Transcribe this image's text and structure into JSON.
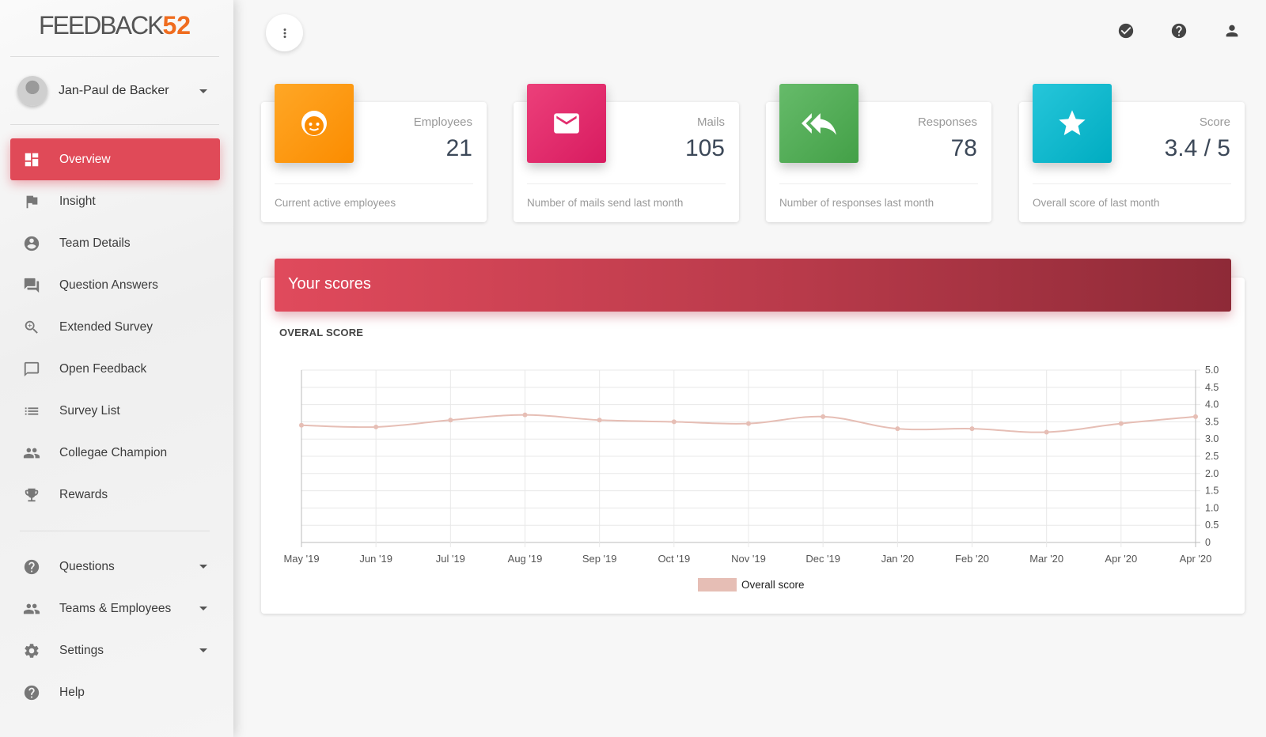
{
  "sidebar": {
    "logo_text": "FEEDBACK",
    "logo_number": "52",
    "user_name": "Jan-Paul de Backer",
    "items": [
      {
        "label": "Overview"
      },
      {
        "label": "Insight"
      },
      {
        "label": "Team Details"
      },
      {
        "label": "Question Answers"
      },
      {
        "label": "Extended Survey"
      },
      {
        "label": "Open Feedback"
      },
      {
        "label": "Survey List"
      },
      {
        "label": "Collegae Champion"
      },
      {
        "label": "Rewards"
      }
    ],
    "sections": [
      {
        "label": "Questions"
      },
      {
        "label": "Teams & Employees"
      },
      {
        "label": "Settings"
      },
      {
        "label": "Help"
      }
    ],
    "active_color": "#e04a58"
  },
  "topbar": {
    "icons": [
      "check-circle-icon",
      "help-circle-icon",
      "person-icon"
    ]
  },
  "stats": [
    {
      "category": "Employees",
      "value": "21",
      "footer": "Current active employees",
      "color": "#fb8c00",
      "icon": "face-icon"
    },
    {
      "category": "Mails",
      "value": "105",
      "footer": "Number of mails send last month",
      "color": "#e91e63",
      "icon": "mail-icon"
    },
    {
      "category": "Responses",
      "value": "78",
      "footer": "Number of responses last month",
      "color": "#4caf50",
      "icon": "reply-all-icon"
    },
    {
      "category": "Score",
      "value": "3.4 / 5",
      "footer": "Overall score of last month",
      "color": "#00bcd4",
      "icon": "star-icon"
    }
  ],
  "scores_panel": {
    "title": "Your scores",
    "subtitle": "OVERAL SCORE"
  },
  "chart_data": {
    "type": "line",
    "title": "OVERAL SCORE",
    "categories": [
      "May '19",
      "Jun '19",
      "Jul '19",
      "Aug '19",
      "Sep '19",
      "Oct '19",
      "Nov '19",
      "Dec '19",
      "Jan '20",
      "Feb '20",
      "Mar '20",
      "Apr '20",
      "Apr '20"
    ],
    "series": [
      {
        "name": "Overall score",
        "values": [
          3.4,
          3.35,
          3.55,
          3.7,
          3.55,
          3.5,
          3.45,
          3.65,
          3.3,
          3.3,
          3.2,
          3.45,
          3.65
        ],
        "color": "#e6beb5"
      }
    ],
    "ylim": [
      0,
      5
    ],
    "yticks": [
      "0",
      "0.5",
      "1.0",
      "1.5",
      "2.0",
      "2.5",
      "3.0",
      "3.5",
      "4.0",
      "4.5",
      "5.0"
    ],
    "y_axis_side": "right",
    "grid": true,
    "legend": "bottom"
  }
}
